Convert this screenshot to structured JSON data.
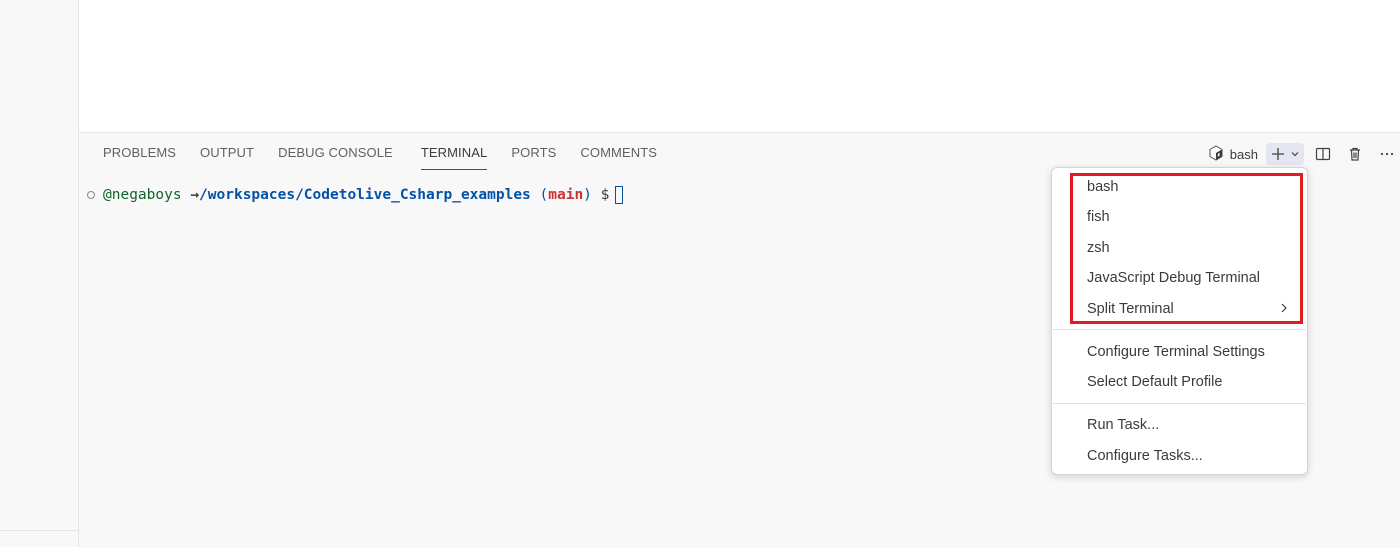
{
  "panel": {
    "tabs": [
      {
        "label": "PROBLEMS"
      },
      {
        "label": "OUTPUT"
      },
      {
        "label": "DEBUG CONSOLE"
      },
      {
        "label": "TERMINAL",
        "active": true
      },
      {
        "label": "PORTS"
      },
      {
        "label": "COMMENTS"
      }
    ],
    "actions": {
      "shell_name": "bash",
      "shell_icon": "terminal-bash-icon",
      "new_terminal_icon": "plus-icon",
      "launch_profile_icon": "chevron-down-icon",
      "split_icon": "split-editor-icon",
      "kill_icon": "trash-icon",
      "more_icon": "ellipsis-icon"
    }
  },
  "terminal": {
    "user": "@negaboys",
    "arrow": "→",
    "path": "/workspaces/Codetolive_Csharp_examples",
    "paren_open": "(",
    "branch": "main",
    "paren_close": ")",
    "prompt": "$"
  },
  "menu": {
    "profiles": [
      "bash",
      "fish",
      "zsh",
      "JavaScript Debug Terminal"
    ],
    "split_terminal": "Split Terminal",
    "settings_group": [
      "Configure Terminal Settings",
      "Select Default Profile"
    ],
    "tasks_group": [
      "Run Task...",
      "Configure Tasks..."
    ]
  },
  "colors": {
    "highlight_border": "#e11d24",
    "active_tab_underline": "#005fb8",
    "terminal_user": "#116329",
    "terminal_path": "#0451a5",
    "terminal_branch": "#cd3131"
  }
}
